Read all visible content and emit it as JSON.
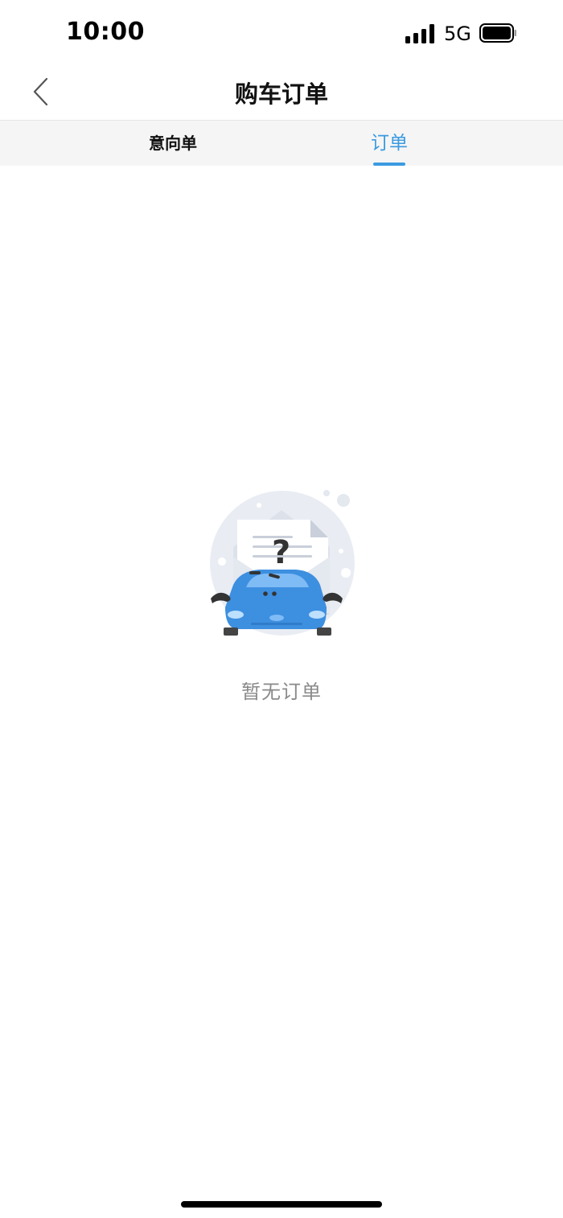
{
  "status_bar": {
    "time": "10:00",
    "network": "5G",
    "icons": [
      "signal-icon",
      "battery-icon"
    ]
  },
  "nav": {
    "title": "购车订单",
    "back_icon": "chevron-left-icon"
  },
  "tabs": [
    {
      "label": "意向单",
      "active": false
    },
    {
      "label": "订单",
      "active": true
    }
  ],
  "empty_state": {
    "message": "暂无订单",
    "illustration": "confused-car-envelope-illustration"
  },
  "colors": {
    "accent": "#3b9be0",
    "tab_bar_bg": "#f5f5f5",
    "empty_text": "#8a8a8a",
    "car": "#3d8fe0"
  }
}
